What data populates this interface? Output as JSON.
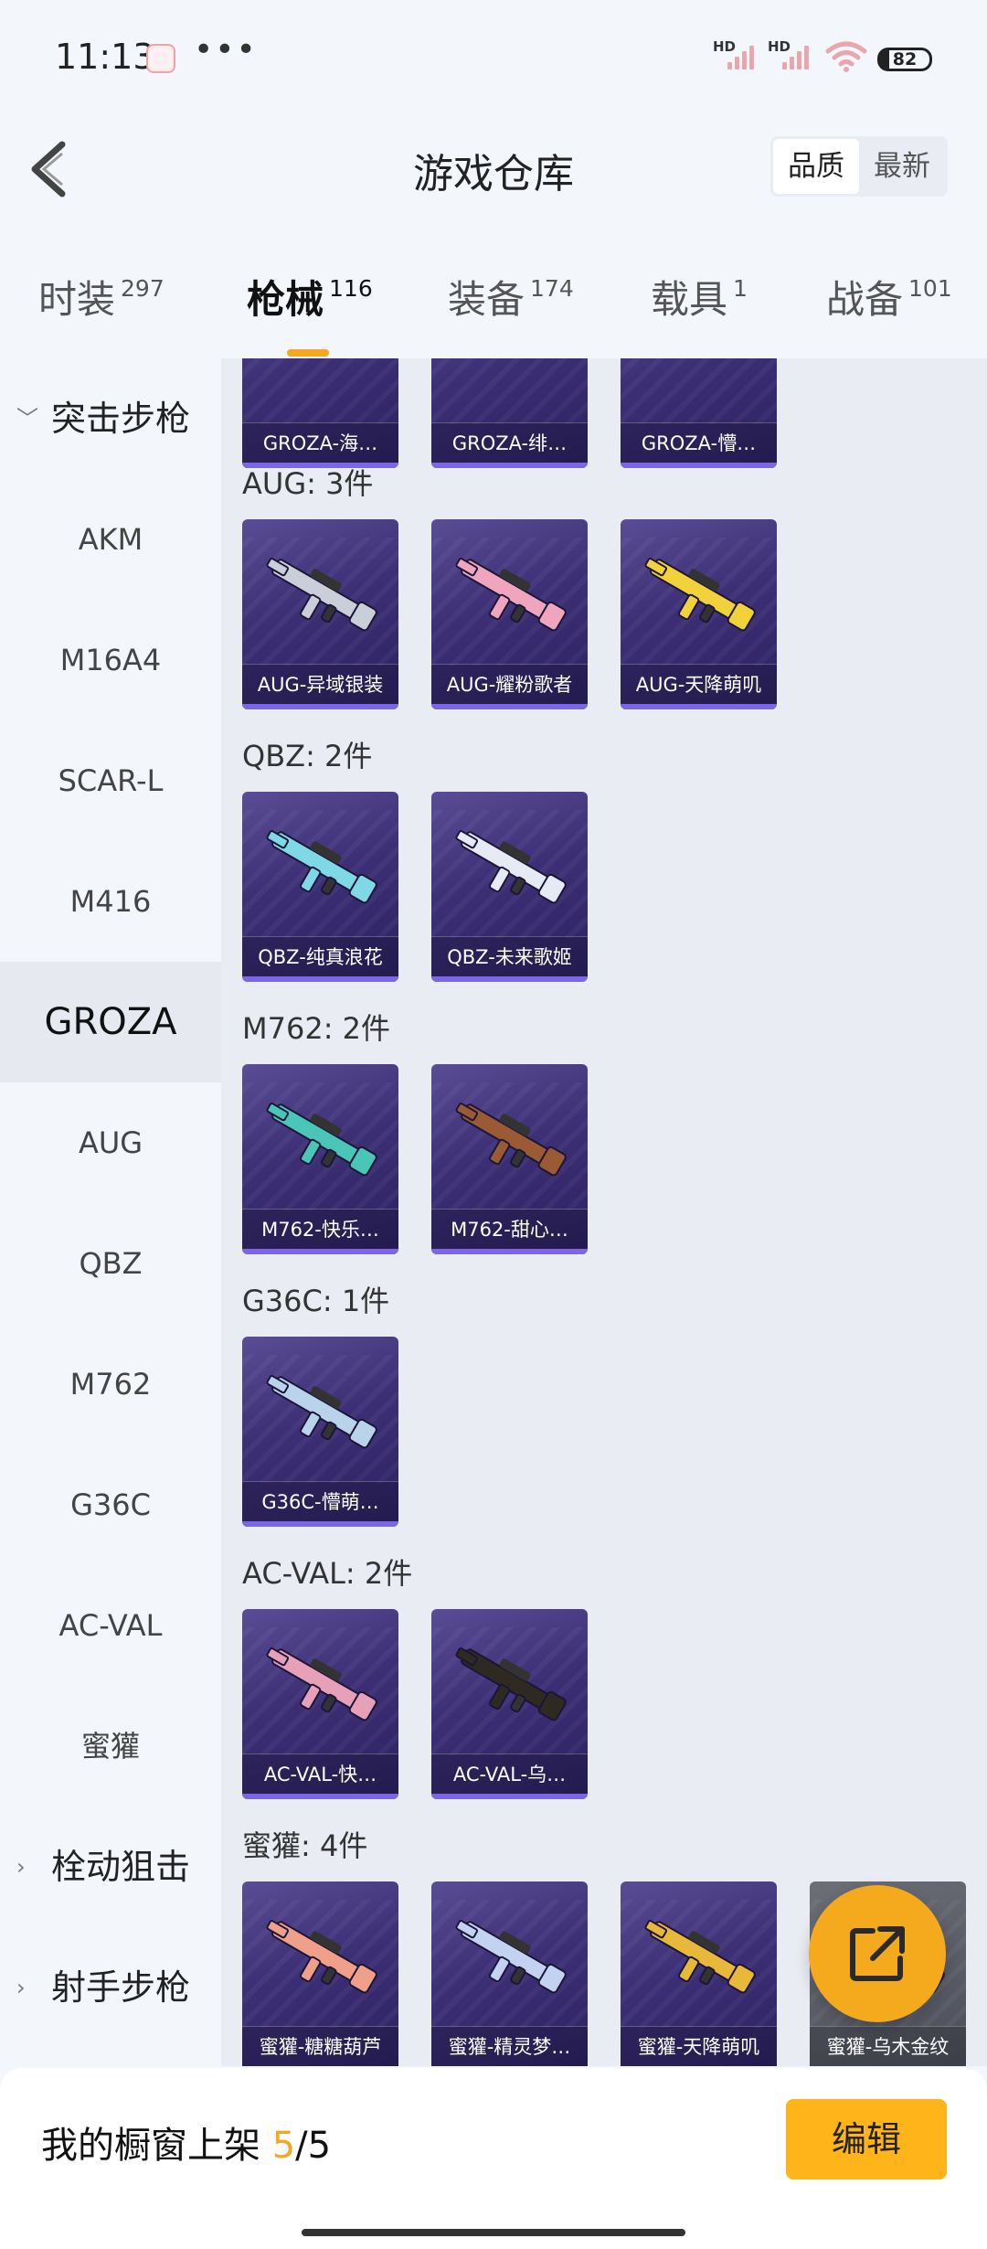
{
  "status_bar": {
    "time": "11:13",
    "network_a": "HD",
    "network_b": "HD",
    "battery": "82"
  },
  "header": {
    "title": "游戏仓库",
    "sort_options": [
      "品质",
      "最新"
    ],
    "active_sort": "品质"
  },
  "tabs": [
    {
      "label": "时装",
      "count": "297"
    },
    {
      "label": "枪械",
      "count": "116"
    },
    {
      "label": "装备",
      "count": "174"
    },
    {
      "label": "载具",
      "count": "1"
    },
    {
      "label": "战备",
      "count": "101"
    }
  ],
  "sidebar": {
    "group_assault": "突击步枪",
    "items": [
      "AKM",
      "M16A4",
      "SCAR-L",
      "M416",
      "GROZA",
      "AUG",
      "QBZ",
      "M762",
      "G36C",
      "AC-VAL",
      "蜜獾"
    ],
    "selected": "GROZA",
    "group_bolt": "栓动狙击",
    "group_marksman": "射手步枪"
  },
  "sections": [
    {
      "title": "",
      "items": [
        "GROZA-海…",
        "GROZA-绯…",
        "GROZA-懵…"
      ]
    },
    {
      "title": "AUG: 3件",
      "items": [
        "AUG-异域银装",
        "AUG-耀粉歌者",
        "AUG-天降萌叽"
      ]
    },
    {
      "title": "QBZ: 2件",
      "items": [
        "QBZ-纯真浪花",
        "QBZ-未来歌姬"
      ]
    },
    {
      "title": "M762: 2件",
      "items": [
        "M762-快乐…",
        "M762-甜心…"
      ]
    },
    {
      "title": "G36C: 1件",
      "items": [
        "G36C-懵萌…"
      ]
    },
    {
      "title": "AC-VAL: 2件",
      "items": [
        "AC-VAL-快…",
        "AC-VAL-乌…"
      ]
    },
    {
      "title": "蜜獾: 4件",
      "items": [
        "蜜獾-糖糖葫芦",
        "蜜獾-精灵梦…",
        "蜜獾-天降萌叽",
        "蜜獾-乌木金纹"
      ]
    }
  ],
  "gun_colors": {
    "aug1": "#c9ced8",
    "aug2": "#f0a5bf",
    "aug3": "#f2d23a",
    "qbz1": "#7fd8e6",
    "qbz2": "#e6eaf5",
    "m7621": "#4ac6b8",
    "m7622": "#9a5a33",
    "g36c1": "#b9d4ea",
    "acval1": "#e6a0b8",
    "acval2": "#2e2a22",
    "honey1": "#f0a08a",
    "honey2": "#c4d2f2",
    "honey3": "#e8b83a",
    "honey4": "#2c2a28"
  },
  "bottom": {
    "showcase_label": "我的橱窗上架 ",
    "current": "5",
    "separator": "/",
    "total": "5",
    "edit_label": "编辑"
  }
}
